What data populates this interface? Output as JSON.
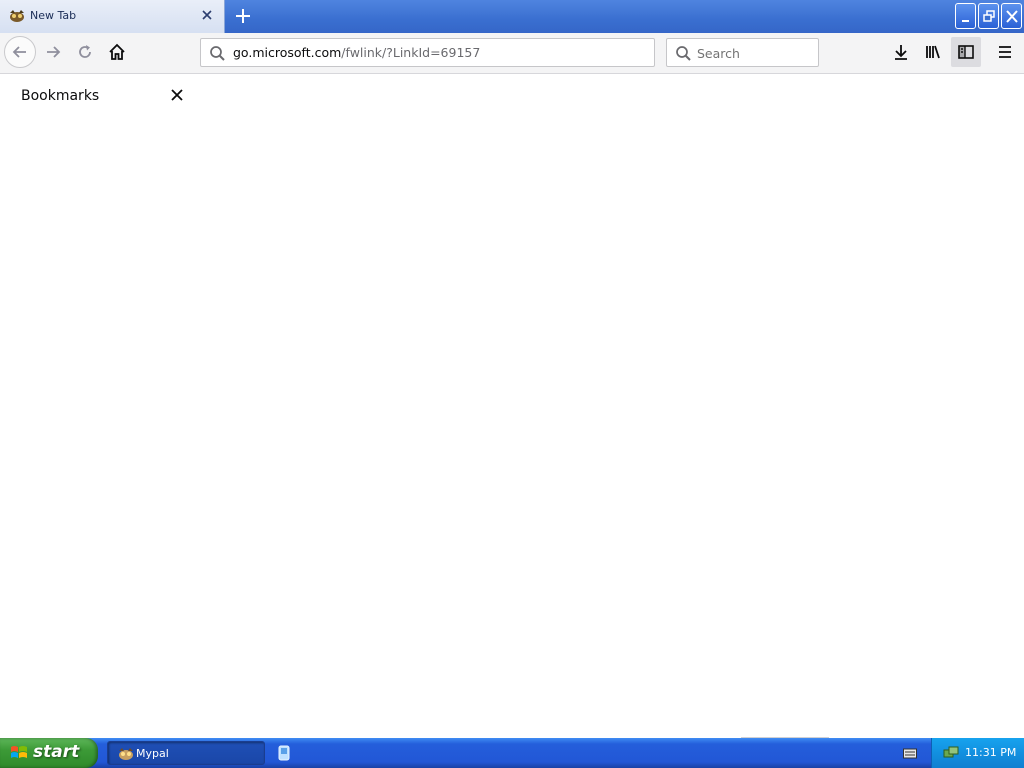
{
  "browser": {
    "tab": {
      "title": "New Tab",
      "favicon": "mypal-icon"
    },
    "url": {
      "host": "go.microsoft.com",
      "path": "/fwlink/?LinkId=69157"
    },
    "search_placeholder": "Search",
    "accent": "#3566c8"
  },
  "sidebar": {
    "title": "Bookmarks"
  },
  "taskbar": {
    "start_label": "start",
    "task_label": "Mypal",
    "clock": "11:31 PM"
  }
}
